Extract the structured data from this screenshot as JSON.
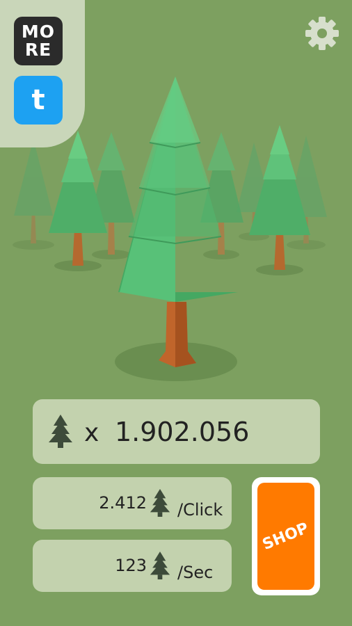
{
  "menu": {
    "more_line1": "MO",
    "more_line2": "RE",
    "tumblr_label": "t",
    "settings_icon": "gear-icon"
  },
  "stats": {
    "total_prefix": "x",
    "total_value": "1.902.056",
    "per_click_value": "2.412",
    "per_click_unit": "/Click",
    "per_sec_value": "123",
    "per_sec_unit": "/Sec"
  },
  "shop": {
    "label": "SHOP"
  },
  "colors": {
    "background": "#7da060",
    "panel": "#c3d2ae",
    "shop_orange": "#ff7a00",
    "tumblr_blue": "#1da1f2"
  }
}
